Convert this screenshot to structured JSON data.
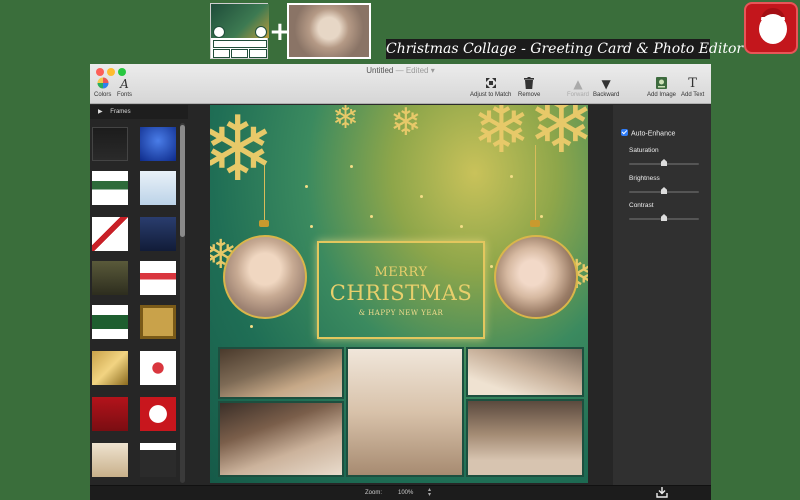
{
  "promo": {
    "title": "Christmas Collage - Greeting Card & Photo Editor",
    "plus": "+"
  },
  "window": {
    "title": "Untitled",
    "edited": "— Edited ▾"
  },
  "toolbar": {
    "colors": "Colors",
    "fonts": "Fonts",
    "adjust": "Adjust to Match",
    "remove": "Remove",
    "forward": "Forward",
    "backward": "Backward",
    "add_image": "Add Image",
    "add_text": "Add Text"
  },
  "sidebar": {
    "header": "Frames"
  },
  "card": {
    "line1": "MERRY",
    "line2": "CHRISTMAS",
    "line3": "& HAPPY NEW YEAR"
  },
  "panel": {
    "auto_enhance": "Auto-Enhance",
    "saturation": "Saturation",
    "brightness": "Brightness",
    "contrast": "Contrast",
    "saturation_level": 0.5,
    "brightness_level": 0.5,
    "contrast_level": 0.5
  },
  "bottom": {
    "zoom_label": "Zoom:",
    "zoom_value": "100%"
  },
  "icons": {
    "colors": "color-wheel-icon",
    "fonts": "font-icon",
    "adjust": "adjust-to-match-icon",
    "remove": "trash-icon",
    "forward": "arrow-up-icon",
    "backward": "arrow-down-icon",
    "add_image": "add-image-icon",
    "add_text": "text-icon",
    "export": "download-icon"
  },
  "colors": {
    "desktop": "#3a6e3b",
    "card_gold": "#e8cf6c",
    "accent_blue": "#2f7cf6"
  }
}
